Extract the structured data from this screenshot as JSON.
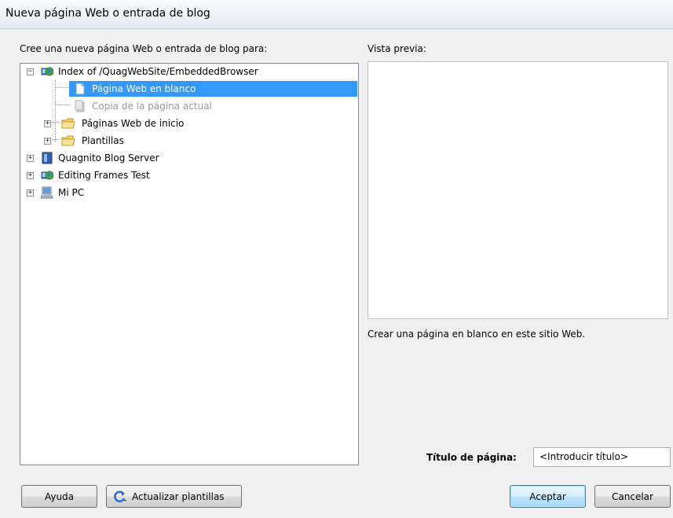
{
  "window": {
    "title": "Nueva página Web o entrada de blog"
  },
  "left": {
    "label": "Cree una nueva página Web o entrada de blog para:"
  },
  "tree": {
    "items": [
      {
        "label": "Index of /QuagWebSite/EmbeddedBrowser",
        "icon": "web-site-icon",
        "expander": "−"
      },
      {
        "label": "Página Web en blanco",
        "icon": "blank-page-icon",
        "selected": true
      },
      {
        "label": "Copia de la página actual",
        "icon": "copy-page-icon",
        "disabled": true
      },
      {
        "label": "Páginas Web de inicio",
        "icon": "folder-icon",
        "expander": "+"
      },
      {
        "label": "Plantillas",
        "icon": "folder-icon",
        "expander": "+"
      },
      {
        "label": "Quagnito Blog Server",
        "icon": "blog-server-icon",
        "expander": "+"
      },
      {
        "label": "Editing Frames Test",
        "icon": "web-site-icon",
        "expander": "+"
      },
      {
        "label": "Mi PC",
        "icon": "computer-icon",
        "expander": "+"
      }
    ]
  },
  "preview": {
    "label": "Vista previa:",
    "description": "Crear una página en blanco en este sitio Web."
  },
  "page_title": {
    "label": "Título de página:",
    "value": "<Introducir título>"
  },
  "buttons": {
    "help": "Ayuda",
    "refresh": "Actualizar plantillas",
    "ok": "Aceptar",
    "cancel": "Cancelar"
  }
}
